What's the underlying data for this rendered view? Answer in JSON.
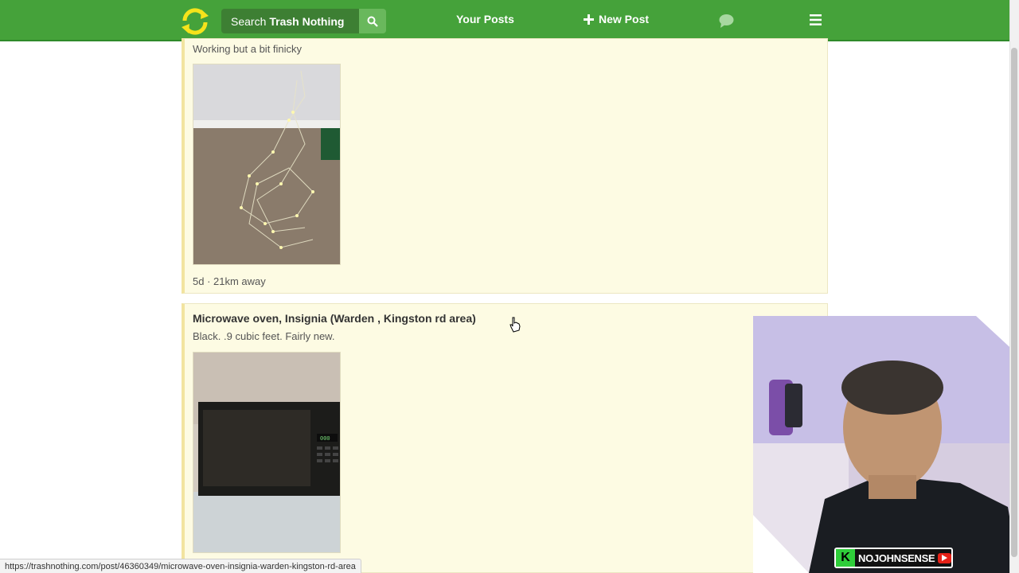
{
  "navbar": {
    "search_prefix": "Search",
    "search_brand": "Trash Nothing",
    "your_posts_label": "Your Posts",
    "new_post_label": "New Post"
  },
  "listings": [
    {
      "title": "",
      "description": "Working but a bit finicky",
      "meta": "5d · 21km away",
      "image_alt": "String lights on floor"
    },
    {
      "title": "Microwave oven, Insignia (Warden , Kingston rd area)",
      "description": "Black. .9 cubic feet. Fairly new.",
      "meta": "",
      "image_alt": "Black microwave oven"
    }
  ],
  "status_bar": {
    "url": "https://trashnothing.com/post/46360349/microwave-oven-insignia-warden-kingston-rd-area"
  },
  "overlay": {
    "channel_name": "NOJOHNSENSE",
    "channel_initial": "K"
  },
  "colors": {
    "navbar": "#45a23a",
    "card_bg": "#fdfbe3",
    "card_accent": "#f2e4a0"
  }
}
